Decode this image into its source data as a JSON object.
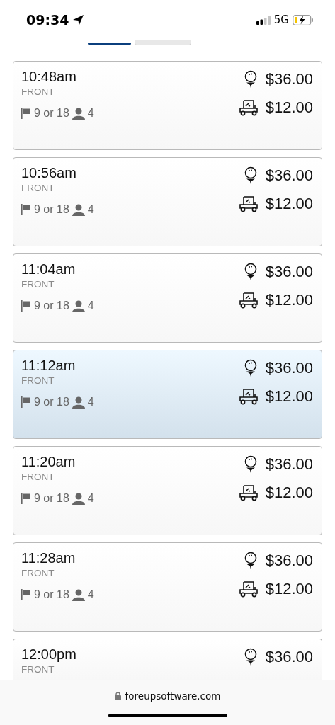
{
  "status_bar": {
    "time": "09:34",
    "network": "5G"
  },
  "tabs": [
    {
      "selected": true
    },
    {
      "selected": false
    }
  ],
  "tee_times": [
    {
      "time": "10:48am",
      "course_side": "FRONT",
      "holes": "9 or 18",
      "players": "4",
      "green_fee": "$36.00",
      "cart_fee": "$12.00",
      "selected": false
    },
    {
      "time": "10:56am",
      "course_side": "FRONT",
      "holes": "9 or 18",
      "players": "4",
      "green_fee": "$36.00",
      "cart_fee": "$12.00",
      "selected": false
    },
    {
      "time": "11:04am",
      "course_side": "FRONT",
      "holes": "9 or 18",
      "players": "4",
      "green_fee": "$36.00",
      "cart_fee": "$12.00",
      "selected": false
    },
    {
      "time": "11:12am",
      "course_side": "FRONT",
      "holes": "9 or 18",
      "players": "4",
      "green_fee": "$36.00",
      "cart_fee": "$12.00",
      "selected": true
    },
    {
      "time": "11:20am",
      "course_side": "FRONT",
      "holes": "9 or 18",
      "players": "4",
      "green_fee": "$36.00",
      "cart_fee": "$12.00",
      "selected": false
    },
    {
      "time": "11:28am",
      "course_side": "FRONT",
      "holes": "9 or 18",
      "players": "4",
      "green_fee": "$36.00",
      "cart_fee": "$12.00",
      "selected": false
    },
    {
      "time": "12:00pm",
      "course_side": "FRONT",
      "green_fee": "$36.00",
      "selected": false
    }
  ],
  "browser_bar": {
    "url": "foreupsoftware.com"
  }
}
